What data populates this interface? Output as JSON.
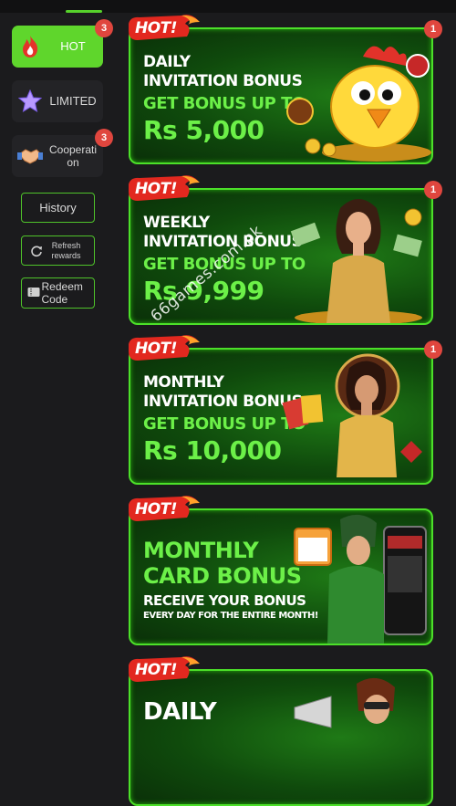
{
  "sidebar": {
    "categories": [
      {
        "label": "HOT",
        "badge": "3",
        "icon": "fire-icon"
      },
      {
        "label": "LIMITED",
        "badge": "",
        "icon": "star-icon"
      },
      {
        "label": "Cooperati on",
        "badge": "3",
        "icon": "handshake-icon"
      }
    ],
    "history_label": "History",
    "refresh_label": "Refresh rewards",
    "redeem_label": "Redeem Code"
  },
  "banners": [
    {
      "tag": "HOT!",
      "line1": "DAILY",
      "line2": "INVITATION BONUS",
      "line3": "GET BONUS UP TO",
      "line4": "Rs 5,000",
      "badge": "1",
      "art": "chicken-mascot"
    },
    {
      "tag": "HOT!",
      "line1": "WEEKLY",
      "line2": "INVITATION BONUS",
      "line3": "GET BONUS UP TO",
      "line4": "Rs 9,999",
      "badge": "1",
      "art": "woman-with-cash"
    },
    {
      "tag": "HOT!",
      "line1": "MONTHLY",
      "line2": "INVITATION BONUS",
      "line3": "GET BONUS UP TO",
      "line4": "Rs 10,000",
      "badge": "1",
      "art": "woman-with-cards"
    },
    {
      "tag": "HOT!",
      "line1": "MONTHLY",
      "line2": "CARD BONUS",
      "line3": "RECEIVE YOUR BONUS",
      "line4": "EVERY DAY FOR THE ENTIRE MONTH!",
      "badge": "",
      "art": "aviator-pilot"
    },
    {
      "tag": "HOT!",
      "line1": "DAILY",
      "line2": "",
      "line3": "",
      "line4": "",
      "badge": "",
      "art": "woman-megaphone"
    }
  ],
  "watermark": "66games.com.pk",
  "colors": {
    "accent": "#5fd62c",
    "badge": "#e0463e",
    "background": "#1b1b1d"
  }
}
